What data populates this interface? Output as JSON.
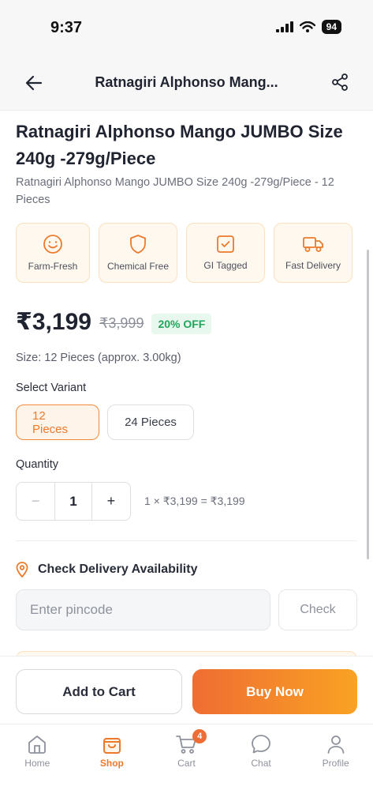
{
  "status_bar": {
    "time": "9:37",
    "battery": "94"
  },
  "header": {
    "title": "Ratnagiri Alphonso Mang..."
  },
  "product": {
    "title": "Ratnagiri Alphonso Mango JUMBO Size 240g -279g/Piece",
    "subtitle": "Ratnagiri Alphonso Mango JUMBO Size 240g -279g/Piece - 12 Pieces"
  },
  "features": [
    {
      "label": "Farm-Fresh",
      "icon": "smile-icon"
    },
    {
      "label": "Chemical Free",
      "icon": "shield-icon"
    },
    {
      "label": "GI Tagged",
      "icon": "check-box-icon"
    },
    {
      "label": "Fast Delivery",
      "icon": "truck-icon"
    }
  ],
  "pricing": {
    "price": "₹3,199",
    "mrp": "₹3,999",
    "discount": "20% OFF"
  },
  "size_text": "Size: 12 Pieces (approx. 3.00kg)",
  "variants": {
    "label": "Select Variant",
    "options": [
      "12 Pieces",
      "24 Pieces"
    ],
    "selected": "12 Pieces"
  },
  "quantity": {
    "label": "Quantity",
    "minus": "−",
    "value": "1",
    "plus": "+",
    "calc": "1 × ₹3,199 = ₹3,199"
  },
  "delivery": {
    "title": "Check Delivery Availability",
    "placeholder": "Enter pincode",
    "check_label": "Check"
  },
  "actions": {
    "add_to_cart": "Add to Cart",
    "buy_now": "Buy Now"
  },
  "tabs": [
    {
      "label": "Home",
      "icon": "home-icon"
    },
    {
      "label": "Shop",
      "icon": "shopping-bag-icon",
      "active": true
    },
    {
      "label": "Cart",
      "icon": "cart-icon",
      "badge": "4"
    },
    {
      "label": "Chat",
      "icon": "chat-icon"
    },
    {
      "label": "Profile",
      "icon": "profile-icon"
    }
  ],
  "colors": {
    "accent": "#ec7a2c",
    "discount": "#22a45a",
    "buy_start": "#ef6d32",
    "buy_end": "#f9a224"
  }
}
